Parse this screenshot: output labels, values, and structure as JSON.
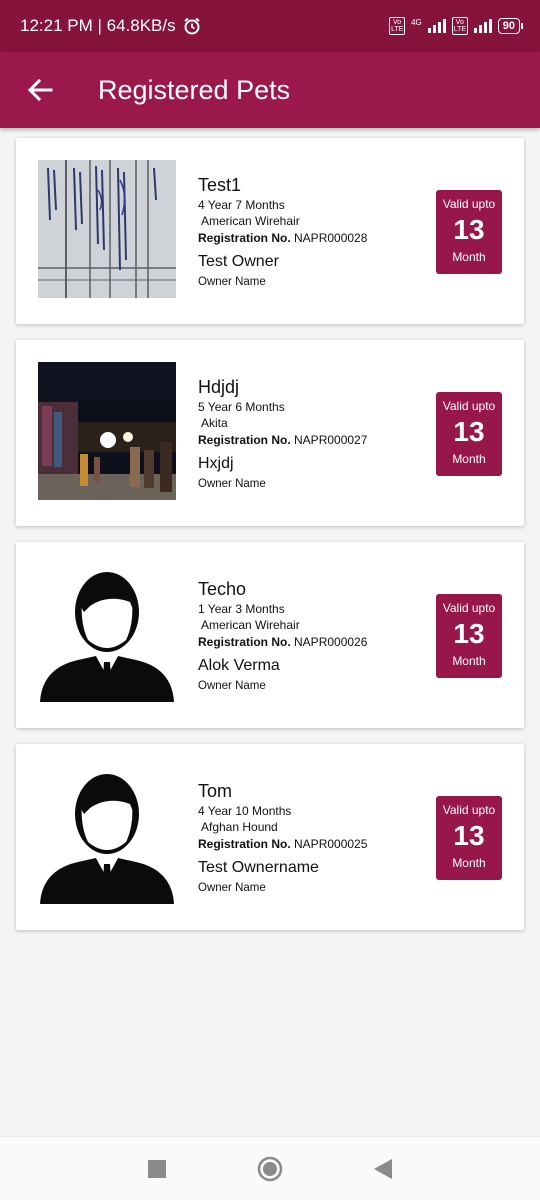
{
  "status_bar": {
    "time": "12:21 PM | 64.8KB/s",
    "network": "4G",
    "volte": "Vo LTE",
    "battery": "90"
  },
  "app_bar": {
    "title": "Registered Pets"
  },
  "labels": {
    "registration_prefix": "Registration No.",
    "owner_name_label": "Owner Name",
    "valid_upto": "Valid upto",
    "month": "Month"
  },
  "pets": [
    {
      "name": "Test1",
      "age": "4 Year 7 Months",
      "breed": "American Wirehair",
      "registration_no": "NAPR000028",
      "owner": "Test Owner",
      "valid_months": "13",
      "photo": "document-photo"
    },
    {
      "name": "Hdjdj",
      "age": "5 Year 6 Months",
      "breed": "Akita",
      "registration_no": "NAPR000027",
      "owner": "Hxjdj",
      "valid_months": "13",
      "photo": "night-market-photo"
    },
    {
      "name": "Techo",
      "age": "1 Year 3 Months",
      "breed": "American Wirehair",
      "registration_no": "NAPR000026",
      "owner": "Alok Verma",
      "valid_months": "13",
      "photo": "person-silhouette"
    },
    {
      "name": "Tom",
      "age": "4 Year 10 Months",
      "breed": "Afghan Hound",
      "registration_no": "NAPR000025",
      "owner": "Test Ownername",
      "valid_months": "13",
      "photo": "person-silhouette"
    }
  ],
  "nav_bar": {
    "buttons": [
      "recents-button",
      "home-button",
      "back-button"
    ]
  }
}
